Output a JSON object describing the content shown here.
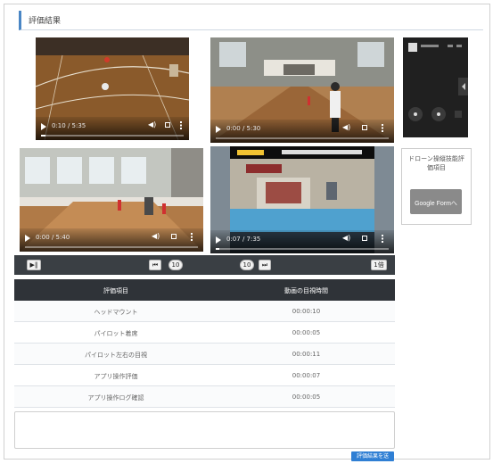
{
  "section": {
    "title": "評価結果"
  },
  "videos": [
    {
      "time": "0:10 / 5:35",
      "progress": 0.03
    },
    {
      "time": "0:00 / 5:30",
      "progress": 0.0
    },
    {
      "time": "0:00 / 5:40",
      "progress": 0.0
    },
    {
      "time": "0:07 / 7:35",
      "progress": 0.02
    }
  ],
  "side_card": {
    "text": "ドローン操縦技能評価項目",
    "button_label": "Google Formへ"
  },
  "toolbar": {
    "btn_playpause": "▶‖",
    "btn_prev": "⏮",
    "btn_back10": "10",
    "btn_fwd10": "10",
    "btn_next": "⏭",
    "btn_speed": "1倍"
  },
  "table": {
    "headers": [
      "評価項目",
      "動画の目視時間"
    ],
    "rows": [
      {
        "name": "ヘッドマウント",
        "time": "00:00:10"
      },
      {
        "name": "パイロット着席",
        "time": "00:00:05"
      },
      {
        "name": "パイロット左右の目視",
        "time": "00:00:11"
      },
      {
        "name": "アプリ操作評価",
        "time": "00:00:07"
      },
      {
        "name": "アプリ操作ログ確認",
        "time": "00:00:05"
      }
    ]
  },
  "comment": {
    "placeholder": ""
  },
  "submit": {
    "label": "評価結果を送信"
  },
  "colors": {
    "accent": "#2f7fd4",
    "header_bar": "#4a86c5",
    "table_head": "#2f3338"
  }
}
